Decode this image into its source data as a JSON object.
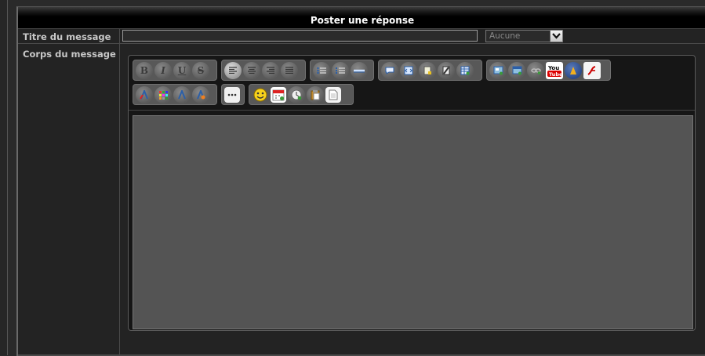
{
  "header": {
    "title": "Poster une réponse"
  },
  "form": {
    "title_label": "Titre du message",
    "title_value": "",
    "icon_select": {
      "selected": "Aucune"
    },
    "body_label": "Corps du message",
    "body_value": ""
  },
  "toolbar": {
    "groups": [
      {
        "name": "text-format",
        "buttons": [
          "bold-icon",
          "italic-icon",
          "underline-icon",
          "strikethrough-icon"
        ],
        "glyphs": [
          "B",
          "I",
          "U",
          "S"
        ]
      },
      {
        "name": "alignment",
        "buttons": [
          "align-left-icon",
          "align-center-icon",
          "align-right-icon",
          "align-justify-icon"
        ]
      },
      {
        "name": "lists",
        "buttons": [
          "bullet-list-icon",
          "numbered-list-icon",
          "horizontal-rule-icon"
        ]
      },
      {
        "name": "blocks",
        "buttons": [
          "quote-icon",
          "code-icon",
          "spoiler-icon",
          "hide-icon",
          "table-icon"
        ]
      },
      {
        "name": "media",
        "buttons": [
          "image-icon",
          "upload-image-icon",
          "link-icon",
          "youtube-icon",
          "dailymotion-icon",
          "flash-icon"
        ]
      },
      {
        "name": "font",
        "buttons": [
          "font-color-icon",
          "color-palette-icon",
          "font-size-icon",
          "font-face-icon"
        ]
      },
      {
        "name": "more",
        "buttons": [
          "more-options-icon"
        ]
      },
      {
        "name": "extras",
        "buttons": [
          "smiley-icon",
          "date-icon",
          "time-icon",
          "paste-icon",
          "new-document-icon"
        ]
      }
    ]
  }
}
